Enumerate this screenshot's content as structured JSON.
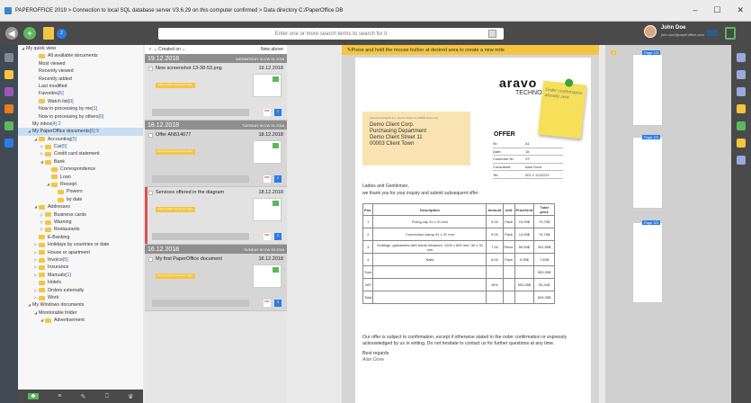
{
  "window": {
    "title": "PAPEROFFICE 2019 > Connection to local SQL database server V3.6.29 on this computer confirmed > Data directory C:/PaperOffice DB",
    "controls": [
      "–",
      "☐",
      "✕"
    ]
  },
  "toolbar": {
    "badge": "2",
    "search_placeholder": "Enter one or more search terms to search for it",
    "user_name": "John Doe",
    "user_email": "john.doe@paperoffice.com"
  },
  "tree": [
    {
      "label": "My quick view",
      "indent": 0,
      "arrow": "◢",
      "folder": false
    },
    {
      "label": "All available documents",
      "indent": 2,
      "folder": true
    },
    {
      "label": "Most viewed",
      "indent": 2,
      "folder": false
    },
    {
      "label": "Recently viewed",
      "indent": 2,
      "folder": false
    },
    {
      "label": "Recently added",
      "indent": 2,
      "folder": false
    },
    {
      "label": "Last modified",
      "indent": 2,
      "folder": false
    },
    {
      "label": "Favorites",
      "count": "[5]",
      "indent": 2,
      "folder": false
    },
    {
      "label": "Watch list",
      "count": "[0]",
      "indent": 2,
      "folder": true
    },
    {
      "label": "Now in processing by me",
      "count": "[1]",
      "indent": 2,
      "folder": false
    },
    {
      "label": "Now in processing by others",
      "count": "[0]",
      "indent": 2,
      "folder": false
    },
    {
      "label": "My inbox",
      "count": "[4] 2",
      "indent": 1,
      "folder": false
    },
    {
      "label": "My PaperOffice documents",
      "count": "[6] 5",
      "indent": 1,
      "arrow": "◢",
      "folder": false,
      "sel": true
    },
    {
      "label": "Accounting",
      "count": "[5]",
      "indent": 2,
      "arrow": "◢",
      "folder": true
    },
    {
      "label": "Car",
      "count": "[5]",
      "indent": 3,
      "arrow": "▷",
      "folder": true
    },
    {
      "label": "Credit card statement",
      "indent": 3,
      "arrow": "▷",
      "folder": true
    },
    {
      "label": "Bank",
      "indent": 3,
      "arrow": "◢",
      "folder": true
    },
    {
      "label": "Correspondence",
      "indent": 4,
      "folder": true
    },
    {
      "label": "Loan",
      "indent": 4,
      "folder": true
    },
    {
      "label": "Receipt",
      "indent": 4,
      "arrow": "◢",
      "folder": true
    },
    {
      "label": "Powers",
      "indent": 5,
      "folder": true
    },
    {
      "label": "by date",
      "indent": 5,
      "folder": true
    },
    {
      "label": "Addresses",
      "indent": 2,
      "arrow": "◢",
      "folder": true
    },
    {
      "label": "Business cards",
      "indent": 3,
      "arrow": "▷",
      "folder": true
    },
    {
      "label": "Warning",
      "indent": 3,
      "arrow": "▷",
      "folder": true
    },
    {
      "label": "Restaurants",
      "indent": 3,
      "arrow": "▷",
      "folder": true
    },
    {
      "label": "E-Banking",
      "indent": 2,
      "folder": true
    },
    {
      "label": "Holidays by countries or date",
      "indent": 2,
      "arrow": "▷",
      "folder": true
    },
    {
      "label": "House or apartment",
      "indent": 2,
      "arrow": "▷",
      "folder": true
    },
    {
      "label": "Invoice",
      "count": "[5]",
      "indent": 2,
      "arrow": "▷",
      "folder": true
    },
    {
      "label": "Insurance",
      "indent": 2,
      "arrow": "▷",
      "folder": true
    },
    {
      "label": "Manuals",
      "count": "[1]",
      "indent": 2,
      "arrow": "▷",
      "folder": true
    },
    {
      "label": "Hotels",
      "indent": 2,
      "folder": true
    },
    {
      "label": "Orders externally",
      "indent": 2,
      "arrow": "▷",
      "folder": true
    },
    {
      "label": "Work",
      "indent": 2,
      "arrow": "▷",
      "folder": true
    },
    {
      "label": "My Windows documents",
      "indent": 1,
      "arrow": "◢",
      "folder": false
    },
    {
      "label": "Monitorable folder",
      "indent": 2,
      "arrow": "◢",
      "folder": false
    },
    {
      "label": "Advertisement",
      "indent": 3,
      "arrow": "◢",
      "folder": true
    }
  ],
  "list": {
    "created_on": "Created on",
    "sort": "New above",
    "cards": [
      {
        "date_header": "19.12.2018",
        "day_header": "WEDNESDAY IN CW 51 2018",
        "name": "New screenshot 13-38-53.png",
        "date": "19.12.2018",
        "tag": "Click to add a document type",
        "style": "light",
        "count": "1"
      },
      {
        "date_header": "18.12.2018",
        "day_header": "TUESDAY IN CW 51 2018",
        "name": "Offer AN514077",
        "date": "18.12.2018",
        "tag": "Click to add a document type",
        "style": "",
        "count": "2"
      },
      {
        "name": "Services offered in the diagram",
        "date": "18.12.2018",
        "tag": "Click to add a document type",
        "style": "redbar light",
        "count": "1"
      },
      {
        "date_header": "16.12.2018",
        "day_header": "SUNDAY IN CW 50 2018",
        "name": "My first PaperOffice document",
        "date": "16.12.2018",
        "tag": "Click to add a document type",
        "style": "",
        "count": "3"
      }
    ]
  },
  "viewer": {
    "hint": "Press and hold the mouse button at desired area to create a new note",
    "doc": {
      "logo": "aravo",
      "logo_sub": "TECHNOLOGY",
      "sticky": "Order confirmation already sent",
      "sender": "www.technologies.inc., Demo Street 11, 00000 Demo city",
      "address": [
        "Demo Client Corp.",
        "Purchasing Department",
        "Demo Client Street 11",
        "00003 Client Town"
      ],
      "offer": "OFFER",
      "kv": [
        [
          "Nr.:",
          "A1"
        ],
        [
          "Date:",
          "18"
        ],
        [
          "Customer Nr.:",
          "XY"
        ],
        [
          "Consultant:",
          "Alan Dove"
        ],
        [
          "Tel.:",
          "001 1 1222222"
        ]
      ],
      "salutation": "Ladies and Gentlemen,",
      "intro": "we thank you for your inquiry and submit subsequent offer:",
      "headers": [
        "Pos.",
        "Description",
        "Amount",
        "Unit",
        "Price/Unit",
        "Total price"
      ],
      "rows": [
        [
          "1",
          "Fixing clip 31 x 31 mm",
          "5.00",
          "Pack",
          "15,95$",
          "79,75$"
        ],
        [
          "2",
          "Connection clamp 31 x 31 mm",
          "5.00",
          "Pack",
          "14,95$",
          "74,75$"
        ],
        [
          "3",
          "Gratings, galvanized with frame Measure: 1200 x 600 mm; 30 x 30 mm",
          "7.00",
          "Piece",
          "55,95$",
          "391,65$"
        ],
        [
          "4",
          "Nails",
          "8.00",
          "Pack",
          "0,95$",
          "7,60$"
        ]
      ],
      "sum": [
        "Sum",
        "",
        "",
        "",
        "",
        "553,95$"
      ],
      "vat": [
        "VAT",
        "",
        "16%",
        "",
        "553,95$",
        "55,40$"
      ],
      "total": [
        "Total",
        "",
        "",
        "",
        "",
        "609,35$"
      ],
      "closing": "Our offer is subject to confirmation, except if otherwise stated in the order confirmation or expressly acknowledged by us in writing. Do not hesitate to contact us for further questions at any time.",
      "regards": "Best regards",
      "signature": "Alan Dove"
    }
  },
  "thumbs": [
    {
      "label": "Page 1/3",
      "badge": "1"
    },
    {
      "label": "Page 2/3"
    },
    {
      "label": "Page 3/3"
    }
  ],
  "colors": {
    "accent": "#5cb85c",
    "blue": "#2c7be5",
    "yellow": "#f4c542",
    "dark": "#4a4a4a"
  }
}
